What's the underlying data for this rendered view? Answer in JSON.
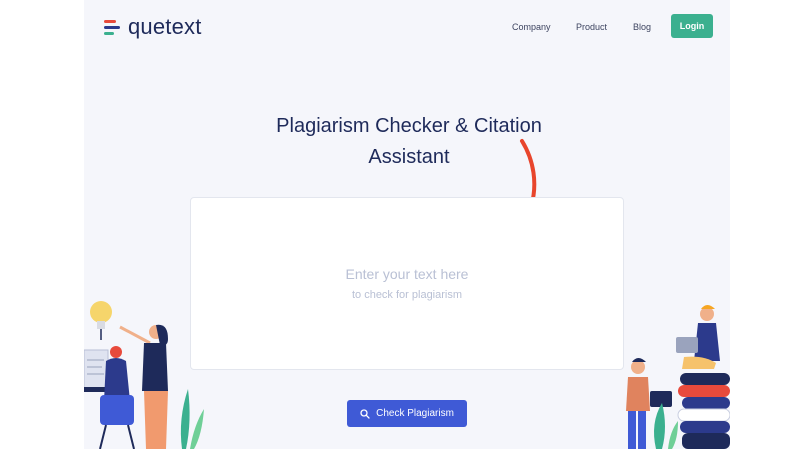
{
  "brand": {
    "name": "quetext"
  },
  "nav": {
    "company": "Company",
    "product": "Product",
    "blog": "Blog",
    "login": "Login"
  },
  "hero": {
    "title": "Plagiarism Checker & Citation Assistant"
  },
  "editor": {
    "placeholder_main": "Enter your text here",
    "placeholder_sub": "to check for plagiarism"
  },
  "actions": {
    "check_label": "Check Plagiarism"
  },
  "colors": {
    "brand_navy": "#1e2a5a",
    "login_green": "#3bb08f",
    "button_blue": "#3f5ad6",
    "arrow_red": "#e8452c"
  },
  "icons": [
    "logo-icon",
    "search-icon",
    "arrow-annotation",
    "left-illustration",
    "right-illustration"
  ]
}
